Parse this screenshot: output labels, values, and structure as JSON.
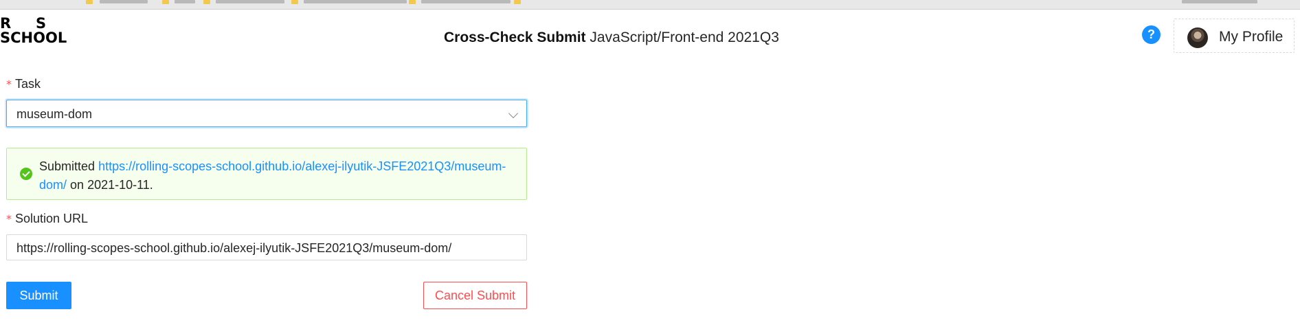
{
  "header": {
    "logo": {
      "line1_left": "R",
      "line1_right": "S",
      "line2": "SCHOOL"
    },
    "title_bold": "Cross-Check Submit",
    "title_rest": "JavaScript/Front-end 2021Q3",
    "help_label": "?",
    "profile_label": "My Profile"
  },
  "form": {
    "task": {
      "required_mark": "*",
      "label": "Task",
      "selected_value": "museum-dom"
    },
    "alert": {
      "prefix": "Submitted",
      "link": "https://rolling-scopes-school.github.io/alexej-ilyutik-JSFE2021Q3/museum-dom/",
      "suffix": "on 2021-10-11."
    },
    "solution_url": {
      "required_mark": "*",
      "label": "Solution URL",
      "value": "https://rolling-scopes-school.github.io/alexej-ilyutik-JSFE2021Q3/museum-dom/"
    },
    "submit_label": "Submit",
    "cancel_label": "Cancel Submit"
  },
  "colors": {
    "primary": "#1890ff",
    "danger": "#ff4d4f",
    "success": "#52c41a",
    "success_bg": "#f6ffed"
  }
}
